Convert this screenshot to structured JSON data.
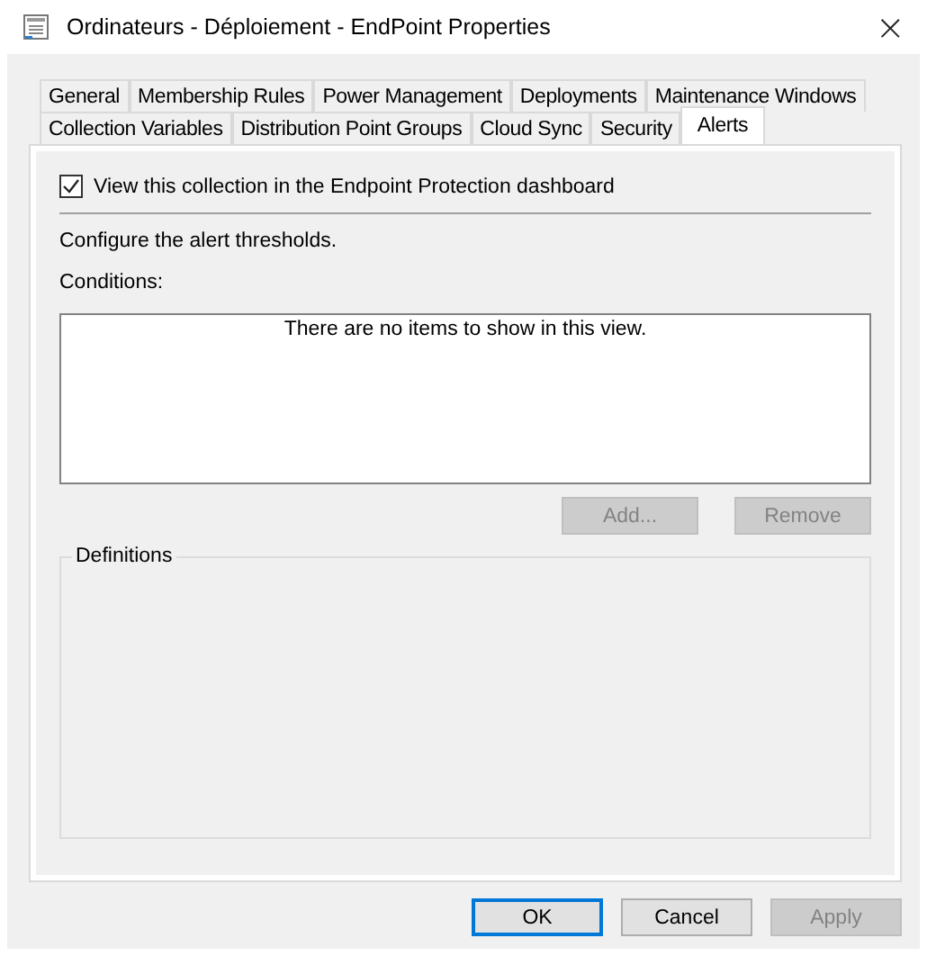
{
  "window": {
    "title": "Ordinateurs - Déploiement - EndPoint Properties",
    "close": "×"
  },
  "tab_rows": [
    [
      {
        "label": "General",
        "selected": false
      },
      {
        "label": "Membership Rules",
        "selected": false
      },
      {
        "label": "Power Management",
        "selected": false
      },
      {
        "label": "Deployments",
        "selected": false
      },
      {
        "label": "Maintenance Windows",
        "selected": false
      }
    ],
    [
      {
        "label": "Collection Variables",
        "selected": false
      },
      {
        "label": "Distribution Point Groups",
        "selected": false
      },
      {
        "label": "Cloud Sync",
        "selected": false
      },
      {
        "label": "Security",
        "selected": false
      },
      {
        "label": "Alerts",
        "selected": true
      }
    ]
  ],
  "dashboard_checkbox": {
    "label": "View this collection in the Endpoint Protection dashboard",
    "checked": true
  },
  "intro": "Configure the alert thresholds.",
  "conditions": {
    "label": "Conditions:",
    "empty_text": "There are no items to show in this view.",
    "buttons": [
      {
        "label": "Add...",
        "disabled": true
      },
      {
        "label": "Remove",
        "disabled": true
      }
    ]
  },
  "definitions": {
    "label": "Definitions"
  },
  "buttons": [
    {
      "label": "OK",
      "default": true,
      "disabled": false
    },
    {
      "label": "Cancel",
      "default": false,
      "disabled": false
    },
    {
      "label": "Apply",
      "default": false,
      "disabled": true
    }
  ]
}
